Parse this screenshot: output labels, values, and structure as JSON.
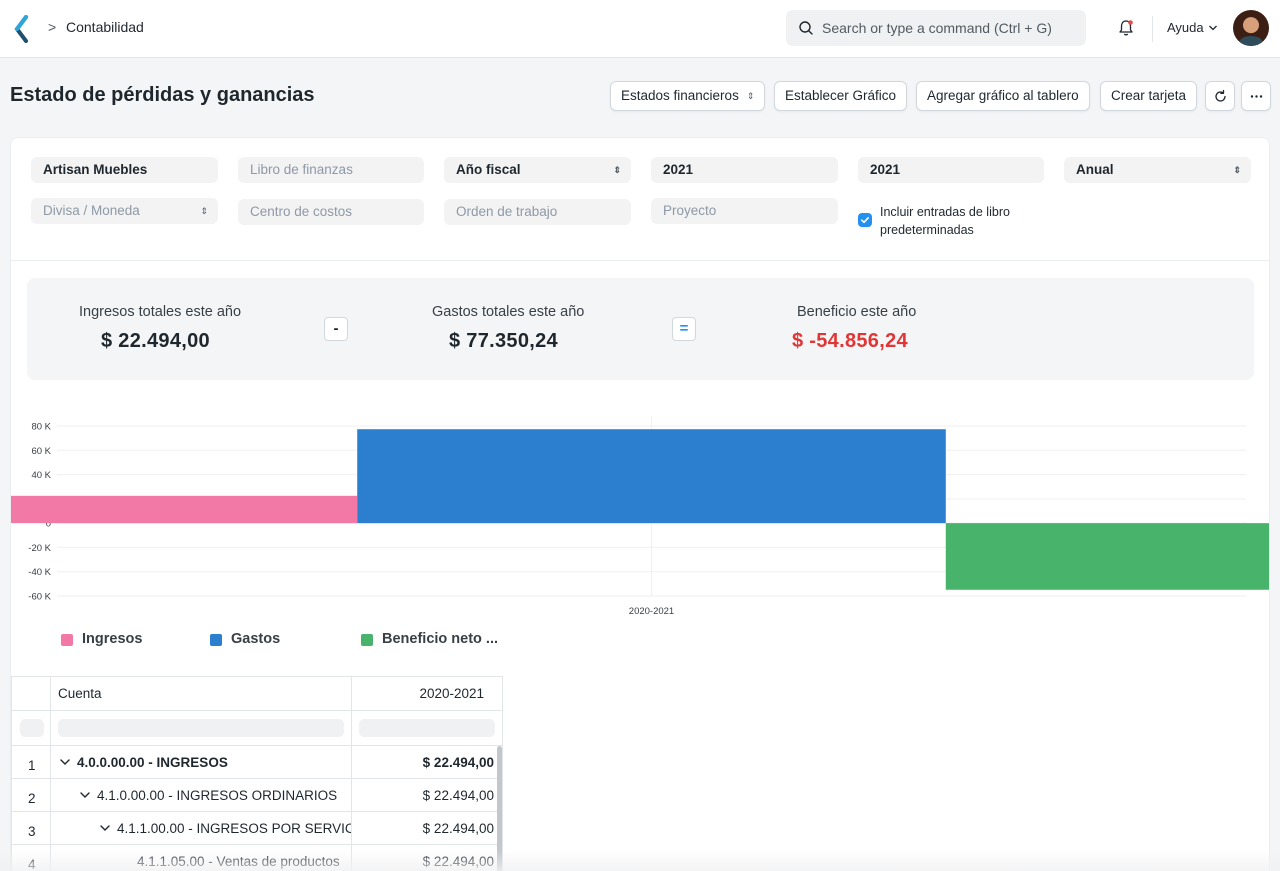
{
  "navbar": {
    "breadcrumb": "Contabilidad",
    "breadcrumb_sep": ">",
    "search_placeholder": "Search or type a command (Ctrl + G)",
    "help_label": "Ayuda"
  },
  "page": {
    "title": "Estado de pérdidas y ganancias",
    "actions": {
      "financial_statements": "Estados financieros",
      "set_chart": "Establecer Gráfico",
      "add_to_dashboard": "Agregar gráfico al tablero",
      "create_card": "Crear tarjeta"
    }
  },
  "filters": {
    "company": "Artisan Muebles",
    "finance_book": "Libro de finanzas",
    "period_type": "Año fiscal",
    "from_year": "2021",
    "to_year": "2021",
    "periodicity": "Anual",
    "currency": "Divisa / Moneda",
    "cost_center": "Centro de costos",
    "work_order": "Orden de trabajo",
    "project": "Proyecto",
    "include_default_book": "Incluir entradas de libro predeterminadas",
    "include_default_book_checked": true
  },
  "summary": {
    "income_label": "Ingresos totales este año",
    "income_value": "$ 22.494,00",
    "minus": "-",
    "expense_label": "Gastos totales este año",
    "expense_value": "$ 77.350,24",
    "equals": "=",
    "profit_label": "Beneficio este año",
    "profit_value": "$ -54.856,24",
    "profit_color": "#e03636"
  },
  "chart_data": {
    "type": "bar",
    "categories": [
      "2020-2021"
    ],
    "series": [
      {
        "name": "Ingresos",
        "values": [
          22494.0
        ],
        "color": "#f279a6"
      },
      {
        "name": "Gastos",
        "values": [
          77350.24
        ],
        "color": "#2c7fce"
      },
      {
        "name": "Beneficio neto ...",
        "values": [
          -54856.24
        ],
        "color": "#47b36b"
      }
    ],
    "ylim": [
      -60000,
      80000
    ],
    "yticks": [
      80000,
      60000,
      40000,
      20000,
      0,
      -20000,
      -40000,
      -60000
    ],
    "ytick_labels": [
      "80 K",
      "60 K",
      "40 K",
      "20 K",
      "0",
      "-20 K",
      "-40 K",
      "-60 K"
    ],
    "grid": true,
    "legend": "bottom-left"
  },
  "table": {
    "headers": [
      "Cuenta",
      "2020-2021"
    ],
    "rows": [
      {
        "idx": "1",
        "account": "4.0.0.00.00 - INGRESOS",
        "amount": "$ 22.494,00",
        "level": 0,
        "bold": true
      },
      {
        "idx": "2",
        "account": "4.1.0.00.00 - INGRESOS ORDINARIOS",
        "amount": "$ 22.494,00",
        "level": 1,
        "bold": false
      },
      {
        "idx": "3",
        "account": "4.1.1.00.00 - INGRESOS POR SERVIC",
        "amount": "$ 22.494,00",
        "level": 2,
        "bold": false
      },
      {
        "idx": "4",
        "account": "4.1.1.05.00 - Ventas de productos",
        "amount": "$ 22.494,00",
        "level": 3,
        "bold": false
      }
    ]
  }
}
